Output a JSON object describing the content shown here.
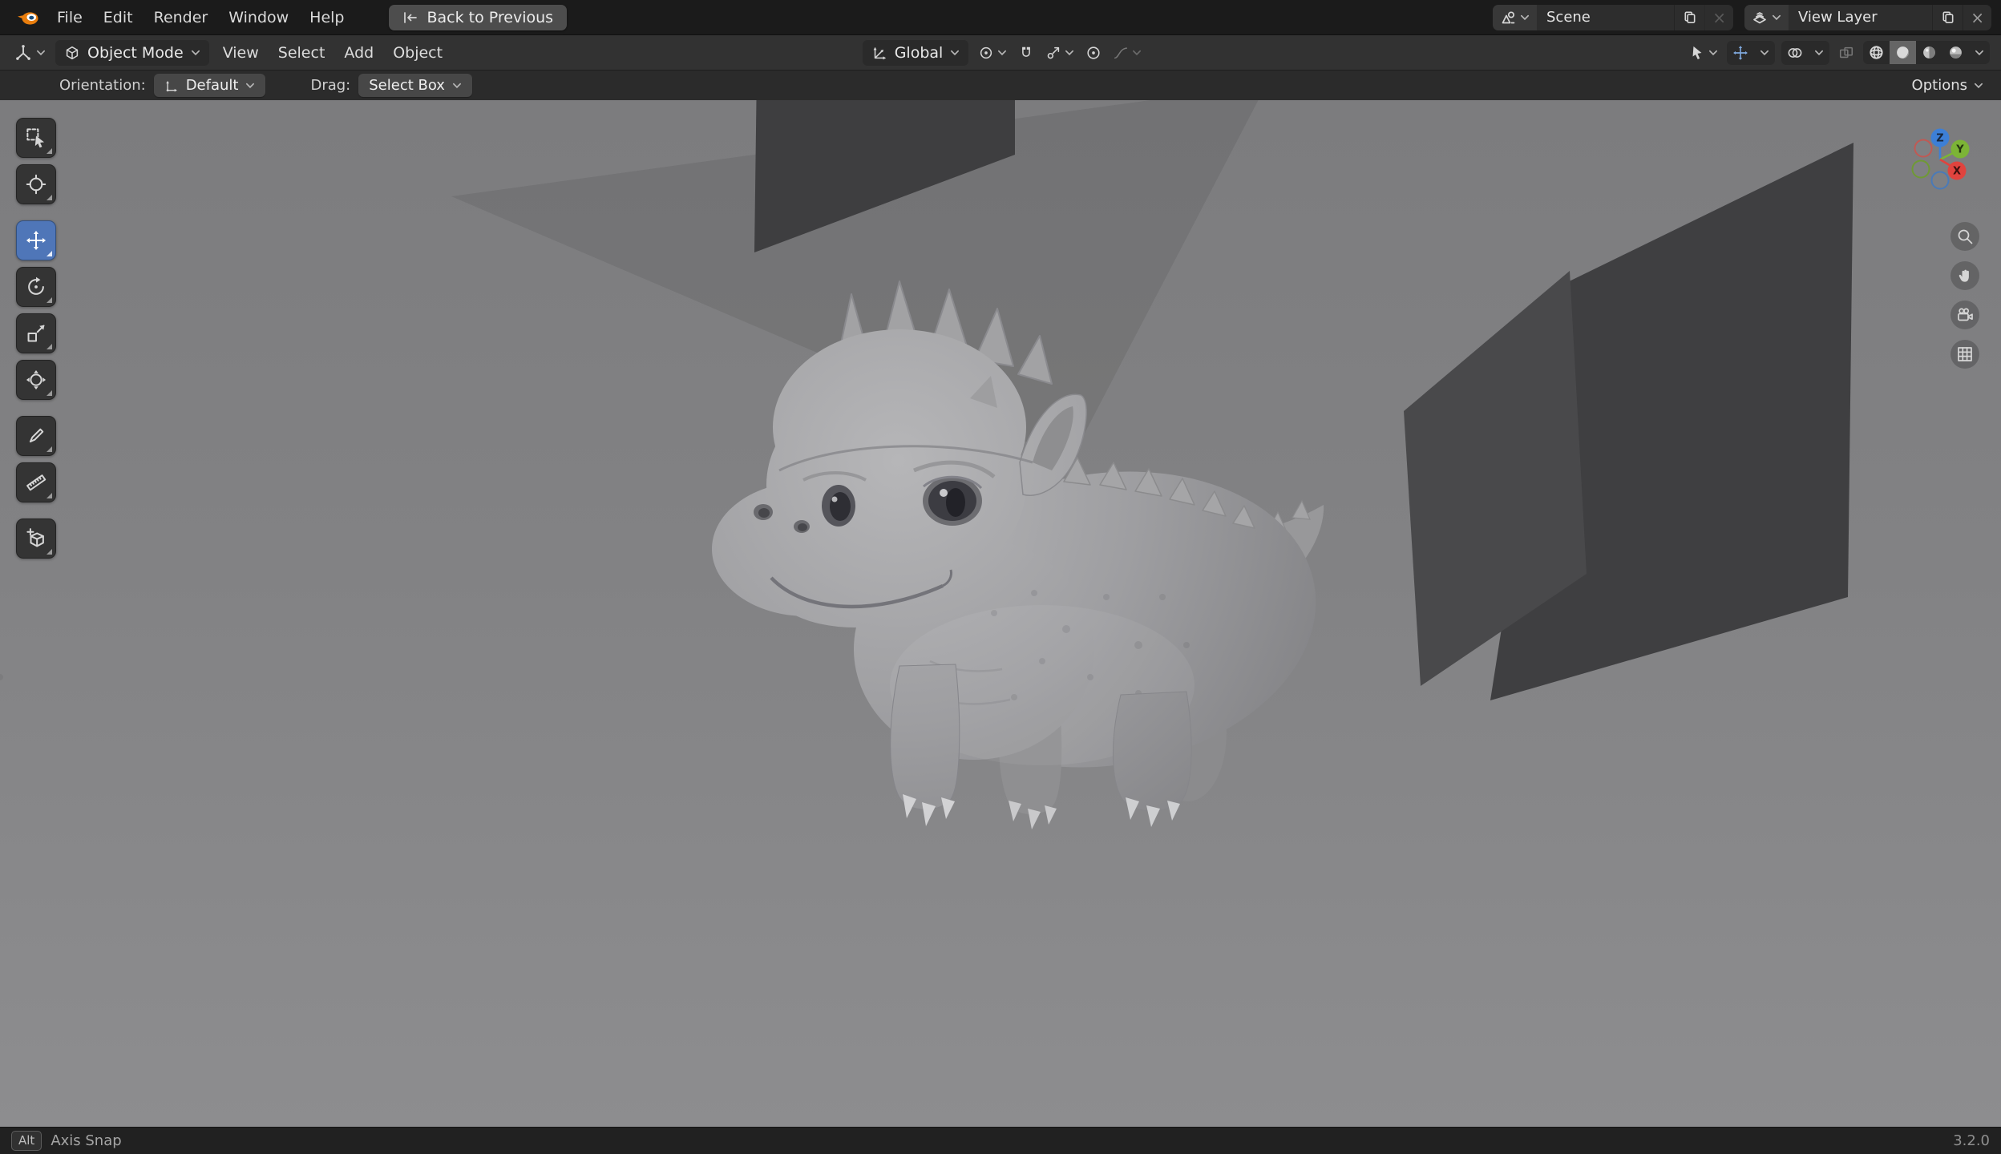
{
  "topbar": {
    "menus": [
      "File",
      "Edit",
      "Render",
      "Window",
      "Help"
    ],
    "back_button": "Back to Previous",
    "scene_name": "Scene",
    "view_layer_name": "View Layer"
  },
  "header": {
    "mode": "Object Mode",
    "menus": [
      "View",
      "Select",
      "Add",
      "Object"
    ],
    "orientation": "Global"
  },
  "tool_settings": {
    "orientation_label": "Orientation:",
    "orientation_value": "Default",
    "drag_label": "Drag:",
    "drag_value": "Select Box",
    "options": "Options"
  },
  "toolbar": {
    "tools": [
      "Select Box",
      "Cursor",
      "Move",
      "Rotate",
      "Scale",
      "Transform",
      "Annotate",
      "Measure",
      "Add Cube"
    ],
    "active_tool": "Move"
  },
  "nav_gizmo": {
    "x_label": "X",
    "y_label": "Y",
    "z_label": "Z"
  },
  "status": {
    "key_hint": "Alt",
    "key_action": "Axis Snap",
    "version": "3.2.0"
  },
  "colors": {
    "accent": "#4F76B8",
    "axis_x": "#E0433E",
    "axis_y": "#7CB436",
    "axis_z": "#3D7FD6",
    "logo_orange": "#E87D0D",
    "unlit_x": "#C05954",
    "unlit_y": "#6F9A34",
    "unlit_z": "#4A7AB8"
  }
}
